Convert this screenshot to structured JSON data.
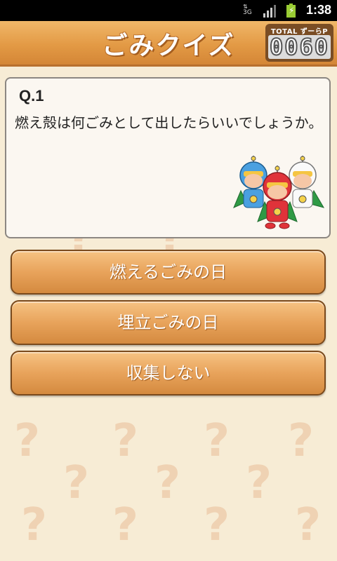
{
  "status_bar": {
    "network": "3G",
    "time": "1:38"
  },
  "header": {
    "title": "ごみクイズ",
    "points_label": "TOTAL ずーらP",
    "points_value": "0060"
  },
  "question": {
    "number": "Q.1",
    "text": "燃え殻は何ごみとして出したらいいでしょうか。"
  },
  "answers": [
    {
      "label": "燃えるごみの日"
    },
    {
      "label": "埋立ごみの日"
    },
    {
      "label": "収集しない"
    }
  ],
  "colors": {
    "header_orange": "#e39a45",
    "button_orange": "#e8a35b",
    "background": "#f7ecd5",
    "card_background": "#fbf7f1"
  }
}
